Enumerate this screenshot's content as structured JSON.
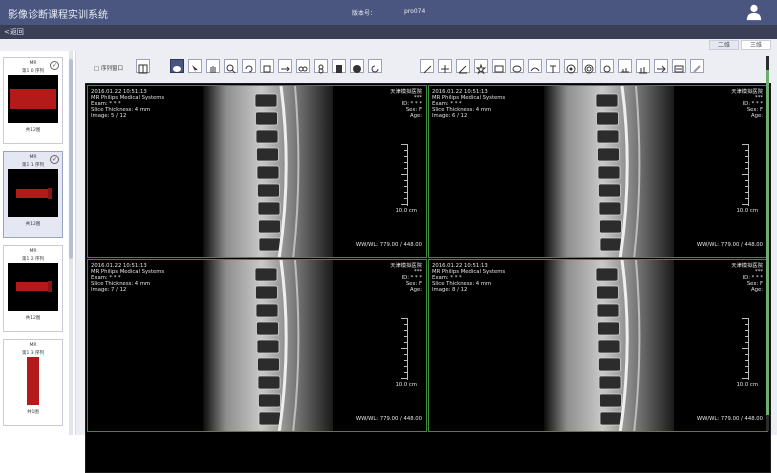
{
  "header": {
    "title": "影像诊断课程实训系统",
    "version_label": "版本号：",
    "version_value": "pro074"
  },
  "nav": {
    "back_label": "<返回"
  },
  "view_tabs": [
    {
      "label": "二维",
      "active": true
    },
    {
      "label": "三维",
      "active": false
    }
  ],
  "sidebar": {
    "thumbnails": [
      {
        "line1": "MR",
        "line2": "第1 0 序列",
        "count": "共12图",
        "selected": false,
        "image": "red block"
      },
      {
        "line1": "MR",
        "line2": "第1 1 序列",
        "count": "共12图",
        "selected": true,
        "image": "red bar"
      },
      {
        "line1": "MR",
        "line2": "第1 2 序列",
        "count": "共12图",
        "selected": false,
        "image": "red bar"
      },
      {
        "line1": "MR",
        "line2": "第1 3 序列",
        "count": "共1图",
        "selected": false,
        "image": "red vertical"
      }
    ]
  },
  "toolbar": {
    "layout_label": "□ 序列窗口",
    "tools": [
      "layout-icon",
      "cursor-icon",
      "select-icon",
      "pan-hand-icon",
      "zoom-icon",
      "rotate-icon",
      "reset-icon",
      "flip-horizontal-icon",
      "flip-vertical-icon",
      "invert-icon",
      "window-level-icon",
      "refresh-icon",
      "pen-icon",
      "crosshair-icon",
      "angle-icon",
      "star-icon",
      "rectangle-icon",
      "ellipse-icon",
      "curve-icon",
      "text-icon",
      "circle-icon",
      "target-icon",
      "dot-icon",
      "ruler-icon",
      "histogram-icon",
      "arrow-icon",
      "label-icon",
      "eraser-icon"
    ]
  },
  "viewer": {
    "panes": [
      {
        "line1": "2016.01.22 10:51:13",
        "line2": "MR Philips Medical Systems",
        "line3": "Exam: * * *",
        "line4": "Slice Thickness: 4  mm",
        "line5": "Image: 5 / 12",
        "hospital": "天津模拟医院",
        "stars": "***",
        "id": "ID: * * *",
        "sex": "Sex: F",
        "age": "Age:",
        "scale": "10.0 cm",
        "wwwl": "WW/WL: 779.00 / 448.00"
      },
      {
        "line1": "2016.01.22 10:51:13",
        "line2": "MR Philips Medical Systems",
        "line3": "Exam: * * *",
        "line4": "Slice Thickness: 4  mm",
        "line5": "Image: 6 / 12",
        "hospital": "天津模拟医院",
        "stars": "***",
        "id": "ID: * * *",
        "sex": "Sex: F",
        "age": "Age:",
        "scale": "10.0 cm",
        "wwwl": "WW/WL: 779.00 / 448.00"
      },
      {
        "line1": "2016.01.22 10:51:13",
        "line2": "MR Philips Medical Systems",
        "line3": "Exam: * * *",
        "line4": "Slice Thickness: 4  mm",
        "line5": "Image: 7 / 12",
        "hospital": "天津模拟医院",
        "stars": "***",
        "id": "ID: * * *",
        "sex": "Sex: F",
        "age": "Age:",
        "scale": "10.0 cm",
        "wwwl": "WW/WL: 779.00 / 448.00"
      },
      {
        "line1": "2016.01.22 10:51:13",
        "line2": "MR Philips Medical Systems",
        "line3": "Exam: * * *",
        "line4": "Slice Thickness: 4  mm",
        "line5": "Image: 8 / 12",
        "hospital": "天津模拟医院",
        "stars": "***",
        "id": "ID: * * *",
        "sex": "Sex: F",
        "age": "Age:",
        "scale": "10.0 cm",
        "wwwl": "WW/WL: 779.00 / 448.00"
      }
    ]
  },
  "colors": {
    "header": "#4a5680",
    "subbar": "#3a3f55",
    "pane_border": "#3b8f3b",
    "thumb_tissue": "#b31b1b"
  }
}
